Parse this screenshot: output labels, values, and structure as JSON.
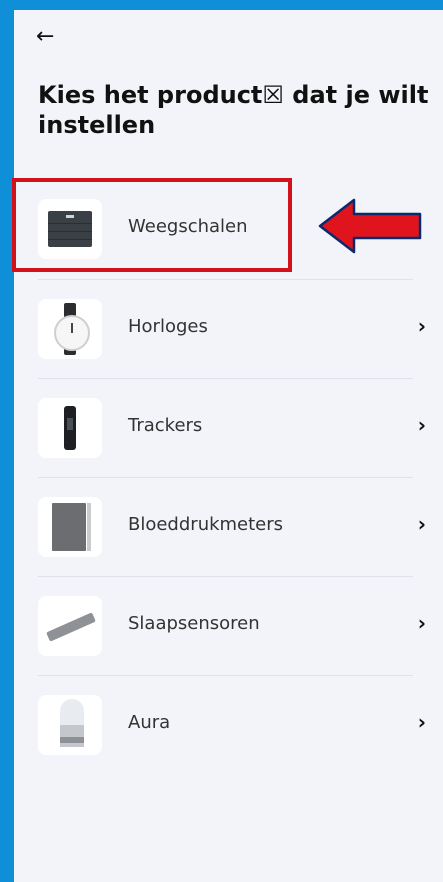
{
  "header": {
    "back_icon": "arrow-left-icon",
    "title": "Kies het product☒ dat je wilt instellen"
  },
  "products": [
    {
      "label": "Weegschalen",
      "icon": "scale-icon",
      "has_chevron": false,
      "highlighted": true
    },
    {
      "label": "Horloges",
      "icon": "watch-icon",
      "has_chevron": true
    },
    {
      "label": "Trackers",
      "icon": "tracker-icon",
      "has_chevron": true
    },
    {
      "label": "Bloeddrukmeters",
      "icon": "blood-pressure-monitor-icon",
      "has_chevron": true
    },
    {
      "label": "Slaapsensoren",
      "icon": "sleep-sensor-icon",
      "has_chevron": true
    },
    {
      "label": "Aura",
      "icon": "aura-icon",
      "has_chevron": true
    }
  ],
  "chevron_glyph": "›",
  "back_glyph": "←",
  "colors": {
    "frame": "#0f8fd8",
    "background": "#f2f4f9",
    "annotation": "#d1121b"
  }
}
